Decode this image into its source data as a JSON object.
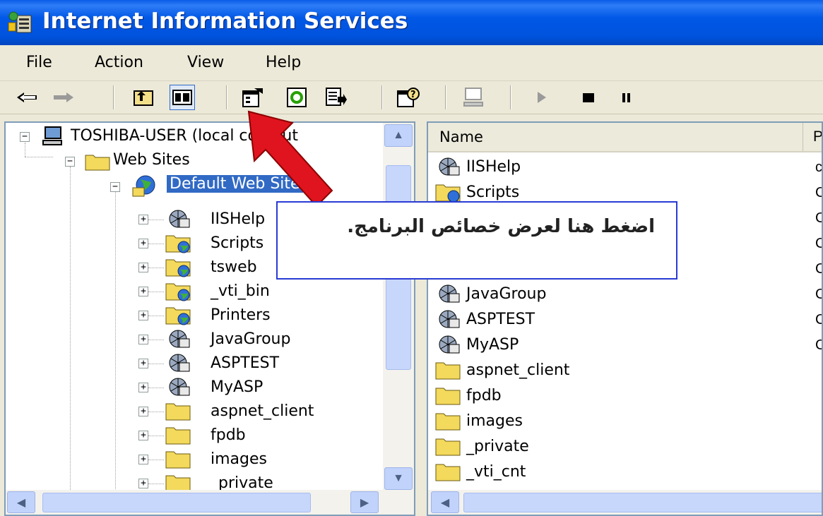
{
  "window": {
    "title": "Internet Information Services"
  },
  "menu": {
    "items": [
      "File",
      "Action",
      "View",
      "Help"
    ]
  },
  "toolbar": {
    "buttons": [
      "back-arrow-icon",
      "forward-arrow-icon",
      "up-folder-icon",
      "show-hide-tree-icon",
      "properties-icon",
      "refresh-icon",
      "export-list-icon",
      "help-icon",
      "computer-icon",
      "play-icon",
      "stop-icon",
      "pause-icon"
    ]
  },
  "tree": {
    "root": "TOSHIBA-USER (local comput",
    "web_sites": "Web Sites",
    "default_site": "Default Web Site",
    "children": [
      "IISHelp",
      "Scripts",
      "tsweb",
      "_vti_bin",
      "Printers",
      "JavaGroup",
      "ASPTEST",
      "MyASP",
      "aspnet_client",
      "fpdb",
      "images",
      "_private"
    ]
  },
  "list": {
    "columns": [
      "Name",
      "P"
    ],
    "rows": [
      {
        "name": "IISHelp",
        "sub": "c"
      },
      {
        "name": "Scripts",
        "sub": "C"
      },
      {
        "name": "",
        "sub": "C"
      },
      {
        "name": "",
        "sub": "C"
      },
      {
        "name": "",
        "sub": "C"
      },
      {
        "name": "JavaGroup",
        "sub": "C"
      },
      {
        "name": "ASPTEST",
        "sub": "C"
      },
      {
        "name": "MyASP",
        "sub": "C"
      },
      {
        "name": "aspnet_client",
        "sub": ""
      },
      {
        "name": "fpdb",
        "sub": ""
      },
      {
        "name": "images",
        "sub": ""
      },
      {
        "name": "_private",
        "sub": ""
      },
      {
        "name": "_vti_cnt",
        "sub": ""
      }
    ]
  },
  "callout": {
    "text": "اضغط هنا لعرض خصائص البرنامج."
  },
  "colors": {
    "titlebar": "#0058e6",
    "selection": "#316ac5",
    "arrow": "#e0141e",
    "callout_border": "#2a3bd4"
  }
}
